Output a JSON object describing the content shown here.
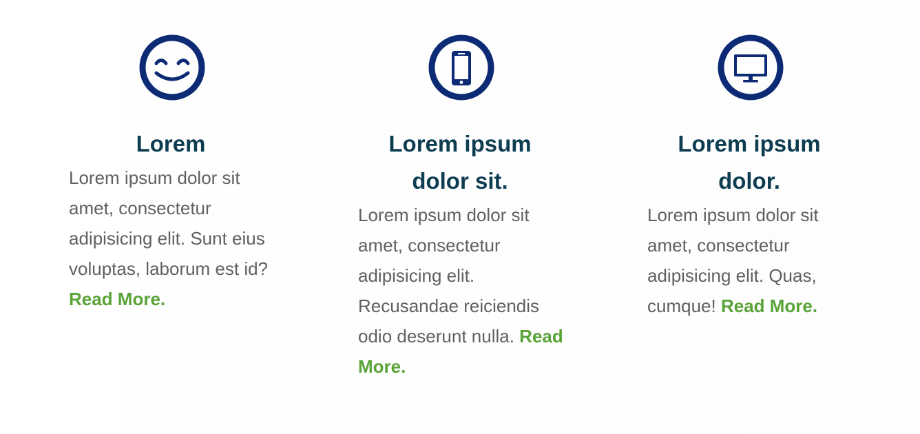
{
  "colors": {
    "title": "#0e3d52",
    "body_text": "#5f6064",
    "link": "#5aa338",
    "icon": "#0d2a75"
  },
  "features": [
    {
      "icon": "smiley-face-icon",
      "title": "Lorem",
      "body": "Lorem ipsum dolor sit amet, consectetur adipisicing elit. Sunt eius voluptas, laborum est id? ",
      "link": "Read More."
    },
    {
      "icon": "mobile-phone-icon",
      "title": "Lorem ipsum dolor sit.",
      "body": "Lorem ipsum dolor sit amet, consectetur adipisicing elit. Recusandae reiciendis odio deserunt nulla. ",
      "link": "Read More."
    },
    {
      "icon": "desktop-monitor-icon",
      "title": "Lorem ipsum dolor.",
      "body": "Lorem ipsum dolor sit amet, consectetur adipisicing elit. Quas, cumque! ",
      "link": "Read More."
    }
  ]
}
